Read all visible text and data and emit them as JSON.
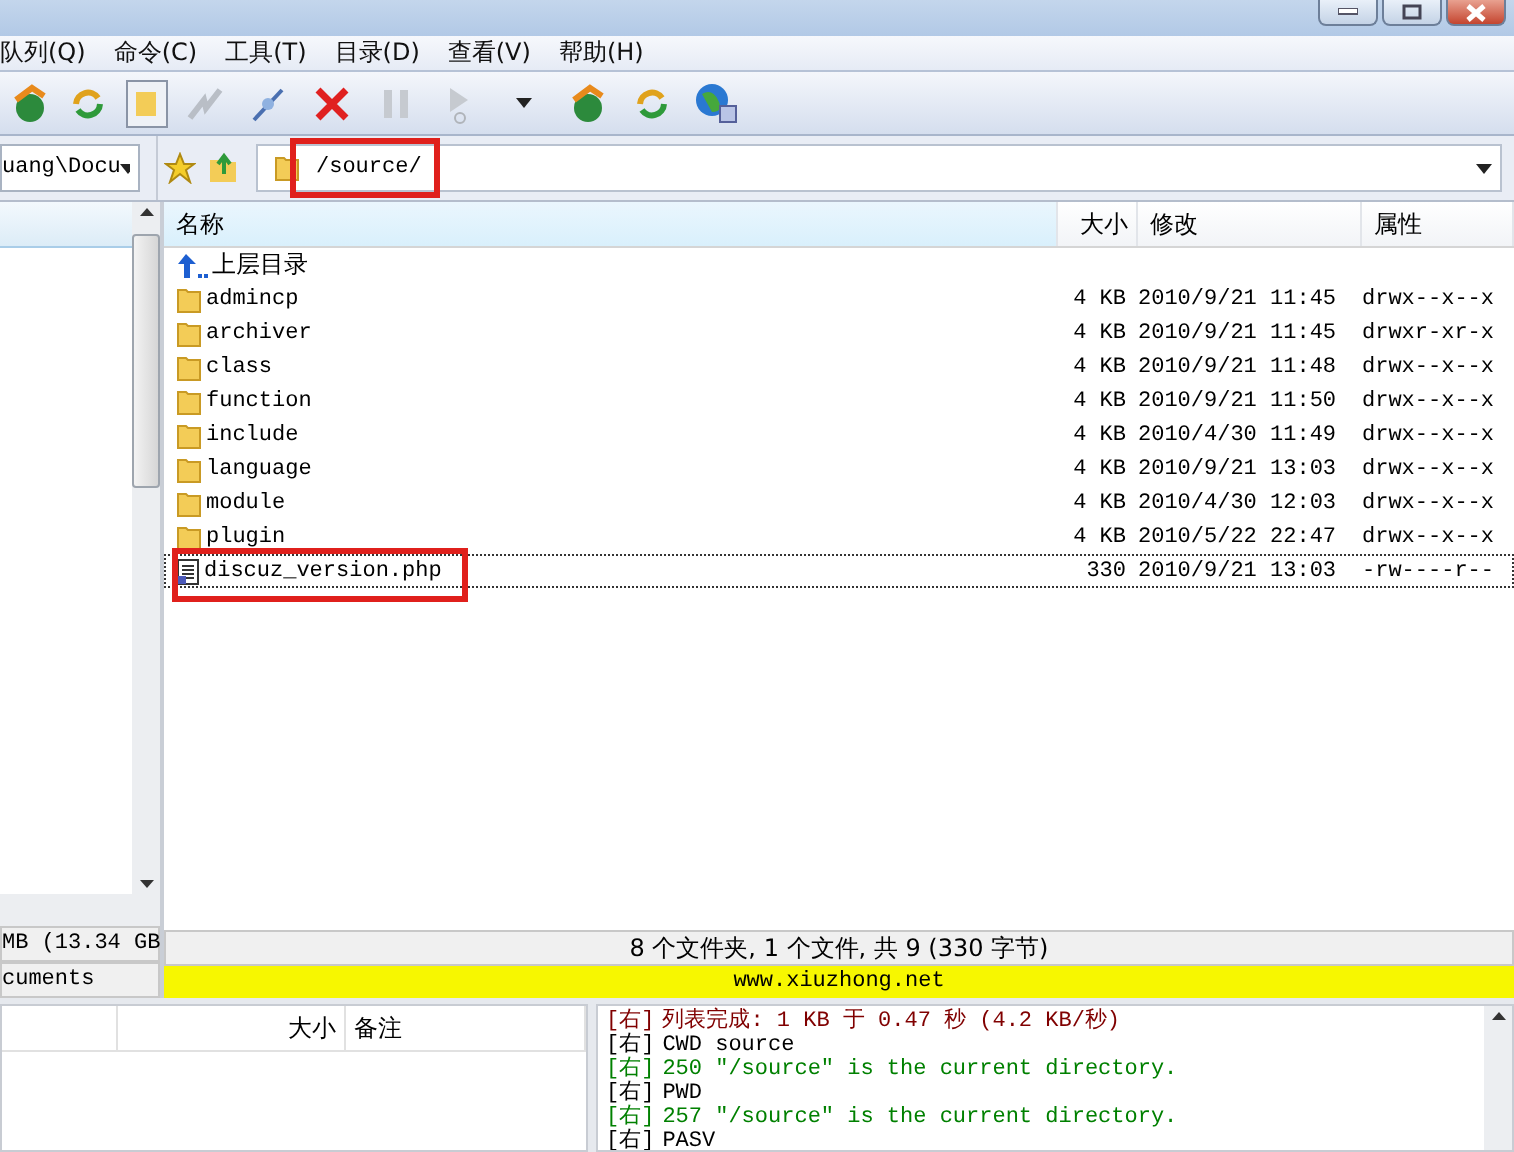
{
  "menu": [
    "队列(Q)",
    "命令(C)",
    "工具(T)",
    "目录(D)",
    "查看(V)",
    "帮助(H)"
  ],
  "left_pane": {
    "path": "uang\\Docu",
    "free_space": "MB (13.34 GB",
    "folder": "cuments"
  },
  "remote_path": {
    "value": "/source/",
    "highlighted": true
  },
  "table": {
    "columns": [
      "名称",
      "大小",
      "修改",
      "属性"
    ],
    "rows": [
      {
        "kind": "up",
        "name": "上层目录",
        "size": "",
        "modified": "",
        "attributes": "",
        "selected": false,
        "highlighted": false
      },
      {
        "kind": "folder",
        "name": "admincp",
        "size": "4 KB",
        "modified": "2010/9/21 11:45",
        "attributes": "drwx--x--x",
        "selected": false,
        "highlighted": false
      },
      {
        "kind": "folder",
        "name": "archiver",
        "size": "4 KB",
        "modified": "2010/9/21 11:45",
        "attributes": "drwxr-xr-x",
        "selected": false,
        "highlighted": false
      },
      {
        "kind": "folder",
        "name": "class",
        "size": "4 KB",
        "modified": "2010/9/21 11:48",
        "attributes": "drwx--x--x",
        "selected": false,
        "highlighted": false
      },
      {
        "kind": "folder",
        "name": "function",
        "size": "4 KB",
        "modified": "2010/9/21 11:50",
        "attributes": "drwx--x--x",
        "selected": false,
        "highlighted": false
      },
      {
        "kind": "folder",
        "name": "include",
        "size": "4 KB",
        "modified": "2010/4/30 11:49",
        "attributes": "drwx--x--x",
        "selected": false,
        "highlighted": false
      },
      {
        "kind": "folder",
        "name": "language",
        "size": "4 KB",
        "modified": "2010/9/21 13:03",
        "attributes": "drwx--x--x",
        "selected": false,
        "highlighted": false
      },
      {
        "kind": "folder",
        "name": "module",
        "size": "4 KB",
        "modified": "2010/4/30 12:03",
        "attributes": "drwx--x--x",
        "selected": false,
        "highlighted": false
      },
      {
        "kind": "folder",
        "name": "plugin",
        "size": "4 KB",
        "modified": "2010/5/22 22:47",
        "attributes": "drwx--x--x",
        "selected": false,
        "highlighted": false
      },
      {
        "kind": "file",
        "name": "discuz_version.php",
        "size": "330",
        "modified": "2010/9/21 13:03",
        "attributes": "-rw----r--",
        "selected": true,
        "highlighted": true
      }
    ]
  },
  "status": "8 个文件夹, 1 个文件, 共 9 (330 字节)",
  "banner": "www.xiuzhong.net",
  "queue": {
    "columns": [
      "大小",
      "备注"
    ]
  },
  "log": [
    {
      "prefix": "[右]",
      "text": "列表完成: 1 KB 于 0.47 秒 (4.2 KB/秒)",
      "color": "#800000"
    },
    {
      "prefix": "[右]",
      "text": "CWD source",
      "color": "#000000"
    },
    {
      "prefix": "[右]",
      "text": "250 \"/source\" is the current directory.",
      "color": "#008000"
    },
    {
      "prefix": "[右]",
      "text": "PWD",
      "color": "#000000"
    },
    {
      "prefix": "[右]",
      "text": "257 \"/source\" is the current directory.",
      "color": "#008000"
    },
    {
      "prefix": "[右]",
      "text": "PASV",
      "color": "#000000"
    }
  ]
}
